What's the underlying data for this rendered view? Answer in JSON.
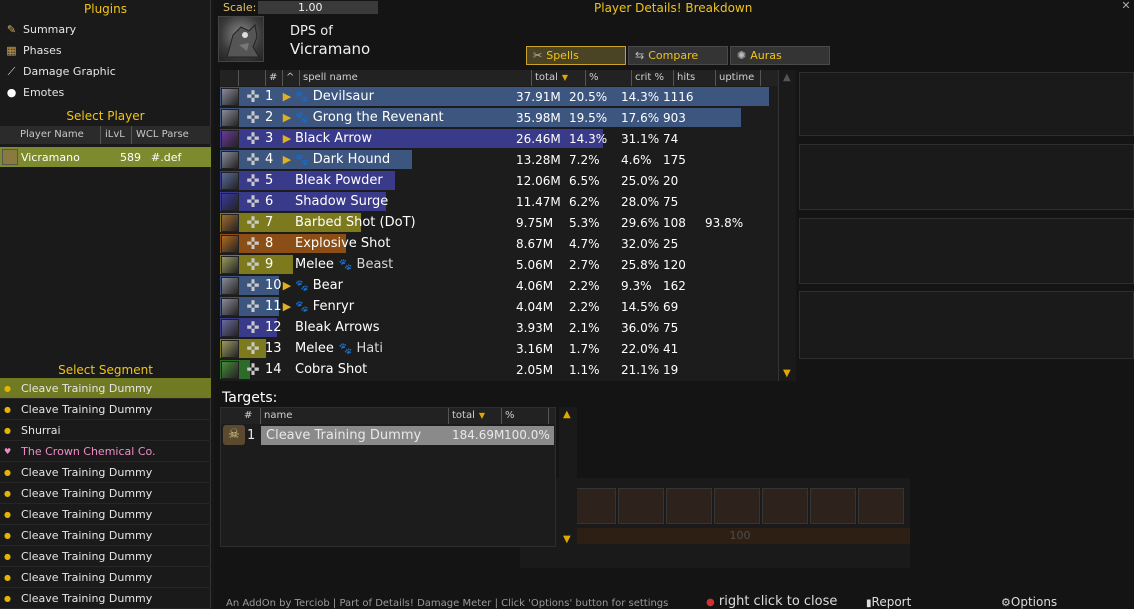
{
  "sidebar": {
    "plugins_title": "Plugins",
    "plugins": [
      {
        "label": "Summary",
        "icon": "scroll-icon",
        "glyph": "✎"
      },
      {
        "label": "Phases",
        "icon": "map-icon",
        "glyph": "▦"
      },
      {
        "label": "Damage Graphic",
        "icon": "chart-icon",
        "glyph": "⟋"
      },
      {
        "label": "Emotes",
        "icon": "speech-bubble-icon",
        "glyph": "●"
      }
    ],
    "select_player_title": "Select Player",
    "player_columns": [
      "Player Name",
      "iLvL",
      "WCL Parse"
    ],
    "player": {
      "name": "Vicramano",
      "ilvl": "589",
      "parse": "#.def"
    },
    "select_segment_title": "Select Segment",
    "segments": [
      {
        "label": "Cleave Training Dummy",
        "selected": true,
        "special": false
      },
      {
        "label": "Cleave Training Dummy",
        "selected": false,
        "special": false
      },
      {
        "label": "Shurrai",
        "selected": false,
        "special": false
      },
      {
        "label": "The Crown Chemical Co.",
        "selected": false,
        "special": true
      },
      {
        "label": "Cleave Training Dummy",
        "selected": false,
        "special": false
      },
      {
        "label": "Cleave Training Dummy",
        "selected": false,
        "special": false
      },
      {
        "label": "Cleave Training Dummy",
        "selected": false,
        "special": false
      },
      {
        "label": "Cleave Training Dummy",
        "selected": false,
        "special": false
      },
      {
        "label": "Cleave Training Dummy",
        "selected": false,
        "special": false
      },
      {
        "label": "Cleave Training Dummy",
        "selected": false,
        "special": false
      },
      {
        "label": "Cleave Training Dummy",
        "selected": false,
        "special": false
      }
    ]
  },
  "header": {
    "scale_label": "Scale:",
    "scale_value": "1.00",
    "window_title": "Player Details! Breakdown",
    "dps_of": "DPS of",
    "player_name": "Vicramano",
    "close": "✕"
  },
  "tabs": [
    {
      "label": "Spells",
      "glyph": "✂",
      "icon": "crossed-swords-icon",
      "active": true
    },
    {
      "label": "Compare",
      "glyph": "⇆",
      "icon": "compare-icon",
      "active": false
    },
    {
      "label": "Auras",
      "glyph": "✺",
      "icon": "aura-icon",
      "active": false
    }
  ],
  "spell_columns": [
    "#",
    "^",
    "spell name",
    "total",
    "%",
    "crit %",
    "hits",
    "uptime"
  ],
  "spells": [
    {
      "idx": "1",
      "name": "Devilsaur",
      "pet": "",
      "expand": true,
      "paw": true,
      "total": "37.91M",
      "pct": "20.5%",
      "crit": "14.3%",
      "hits": "1116",
      "uptime": "",
      "bar_pct": 100,
      "bar_color": "#3c5680",
      "icon_color": "#8a8a9a"
    },
    {
      "idx": "2",
      "name": "Grong the Revenant",
      "pet": "",
      "expand": true,
      "paw": true,
      "total": "35.98M",
      "pct": "19.5%",
      "crit": "17.6%",
      "hits": "903",
      "uptime": "",
      "bar_pct": 94.9,
      "bar_color": "#3c5680",
      "icon_color": "#8a8a9a"
    },
    {
      "idx": "3",
      "name": "Black Arrow",
      "pet": "",
      "expand": true,
      "paw": false,
      "total": "26.46M",
      "pct": "14.3%",
      "crit": "31.1%",
      "hits": "74",
      "uptime": "",
      "bar_pct": 69.8,
      "bar_color": "#3a3a8a",
      "icon_color": "#6b3a9a"
    },
    {
      "idx": "4",
      "name": "Dark Hound",
      "pet": "",
      "expand": true,
      "paw": true,
      "total": "13.28M",
      "pct": "7.2%",
      "crit": "4.6%",
      "hits": "175",
      "uptime": "",
      "bar_pct": 35.0,
      "bar_color": "#3c5680",
      "icon_color": "#8a8a9a"
    },
    {
      "idx": "5",
      "name": "Bleak Powder",
      "pet": "",
      "expand": false,
      "paw": false,
      "total": "12.06M",
      "pct": "6.5%",
      "crit": "25.0%",
      "hits": "20",
      "uptime": "",
      "bar_pct": 31.8,
      "bar_color": "#3a3a8a",
      "icon_color": "#5a6a9a"
    },
    {
      "idx": "6",
      "name": "Shadow Surge",
      "pet": "",
      "expand": false,
      "paw": false,
      "total": "11.47M",
      "pct": "6.2%",
      "crit": "28.0%",
      "hits": "75",
      "uptime": "",
      "bar_pct": 30.3,
      "bar_color": "#3a3a8a",
      "icon_color": "#3a3aa0"
    },
    {
      "idx": "7",
      "name": "Barbed Shot (DoT)",
      "pet": "",
      "expand": false,
      "paw": false,
      "total": "9.75M",
      "pct": "5.3%",
      "crit": "29.6%",
      "hits": "108",
      "uptime": "93.8%",
      "bar_pct": 25.7,
      "bar_color": "#7d7a1e",
      "icon_color": "#a06a30"
    },
    {
      "idx": "8",
      "name": "Explosive Shot",
      "pet": "",
      "expand": false,
      "paw": false,
      "total": "8.67M",
      "pct": "4.7%",
      "crit": "32.0%",
      "hits": "25",
      "uptime": "",
      "bar_pct": 22.9,
      "bar_color": "#8a4e16",
      "icon_color": "#b06a20"
    },
    {
      "idx": "9",
      "name": "Melee",
      "pet": "Beast",
      "expand": false,
      "paw": false,
      "total": "5.06M",
      "pct": "2.7%",
      "crit": "25.8%",
      "hits": "120",
      "uptime": "",
      "bar_pct": 13.3,
      "bar_color": "#7d7a1e",
      "icon_color": "#9a9a60"
    },
    {
      "idx": "10",
      "name": "Bear",
      "pet": "",
      "expand": true,
      "paw": true,
      "total": "4.06M",
      "pct": "2.2%",
      "crit": "9.3%",
      "hits": "162",
      "uptime": "",
      "bar_pct": 10.7,
      "bar_color": "#3c5680",
      "icon_color": "#8a8a9a"
    },
    {
      "idx": "11",
      "name": "Fenryr",
      "pet": "",
      "expand": true,
      "paw": true,
      "total": "4.04M",
      "pct": "2.2%",
      "crit": "14.5%",
      "hits": "69",
      "uptime": "",
      "bar_pct": 10.7,
      "bar_color": "#3c5680",
      "icon_color": "#8a8a9a"
    },
    {
      "idx": "12",
      "name": "Bleak Arrows",
      "pet": "",
      "expand": false,
      "paw": false,
      "total": "3.93M",
      "pct": "2.1%",
      "crit": "36.0%",
      "hits": "75",
      "uptime": "",
      "bar_pct": 10.4,
      "bar_color": "#3a3a8a",
      "icon_color": "#6a6aa0"
    },
    {
      "idx": "13",
      "name": "Melee",
      "pet": "Hati",
      "expand": false,
      "paw": false,
      "total": "3.16M",
      "pct": "1.7%",
      "crit": "22.0%",
      "hits": "41",
      "uptime": "",
      "bar_pct": 8.3,
      "bar_color": "#7d7a1e",
      "icon_color": "#9a9a60"
    },
    {
      "idx": "14",
      "name": "Cobra Shot",
      "pet": "",
      "expand": false,
      "paw": false,
      "total": "2.05M",
      "pct": "1.1%",
      "crit": "21.1%",
      "hits": "19",
      "uptime": "",
      "bar_pct": 5.4,
      "bar_color": "#2e6a2a",
      "icon_color": "#4a8a3a"
    }
  ],
  "targets": {
    "title": "Targets:",
    "columns": [
      "#",
      "name",
      "total",
      "%"
    ],
    "rows": [
      {
        "idx": "1",
        "name": "Cleave Training Dummy",
        "total": "184.69M",
        "pct": "100.0%"
      }
    ]
  },
  "ghost": {
    "bar_text": "100"
  },
  "footer": {
    "credits": "An AddOn by Terciob | Part of Details! Damage Meter | Click 'Options' button for settings",
    "right_click": "right click to close",
    "report": "Report",
    "options": "Options"
  }
}
